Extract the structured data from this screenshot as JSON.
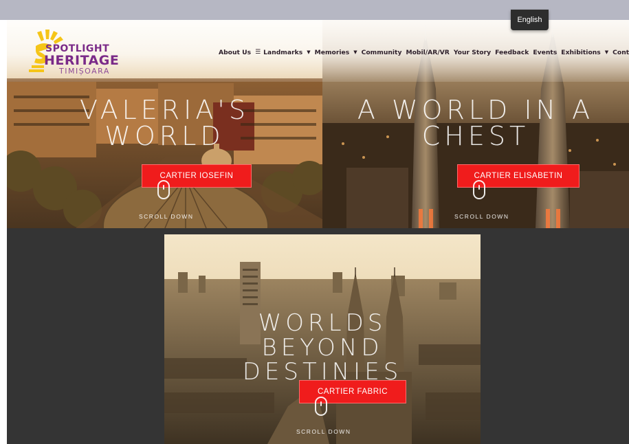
{
  "language_button": "English",
  "logo": {
    "line1": "SPOTLIGHT",
    "line2": "HERITAGE",
    "line3": "TIMIȘOARA"
  },
  "nav": [
    {
      "label": "About Us",
      "has_dropdown": false
    },
    {
      "label": "Landmarks",
      "has_dropdown": true,
      "icon": "list-icon"
    },
    {
      "label": "Memories",
      "has_dropdown": true
    },
    {
      "label": "Community",
      "has_dropdown": false
    },
    {
      "label": "Mobil/AR/VR",
      "has_dropdown": false
    },
    {
      "label": "Your Story",
      "has_dropdown": false
    },
    {
      "label": "Feedback",
      "has_dropdown": false
    },
    {
      "label": "Events",
      "has_dropdown": false
    },
    {
      "label": "Exhibitions",
      "has_dropdown": true
    },
    {
      "label": "Contact",
      "has_dropdown": false
    }
  ],
  "panels": {
    "left": {
      "title_line1": "VALERIA'S",
      "title_line2": "WORLD",
      "button": "CARTIER IOSEFIN",
      "scroll": "SCROLL DOWN"
    },
    "right": {
      "title_line1": "A WORLD IN A",
      "title_line2": "CHEST",
      "button": "CARTIER ELISABETIN",
      "scroll": "SCROLL DOWN"
    },
    "bottom": {
      "title_line1": "WORLDS",
      "title_line2": "BEYOND",
      "title_line3": "DESTINIES",
      "button": "CARTIER FABRIC",
      "scroll": "SCROLL DOWN"
    }
  },
  "colors": {
    "accent_red": "#f01c1c",
    "logo_purple": "#7a2a88",
    "logo_yellow": "#f5c518",
    "page_background": "#343434"
  }
}
